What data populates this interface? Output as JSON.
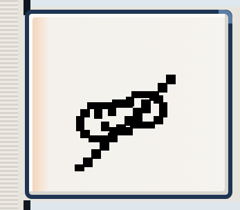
{
  "toolbar": {
    "button": {
      "icon": "unlink-icon",
      "icon_color": "#000000",
      "border_color": "#1d3552"
    }
  }
}
